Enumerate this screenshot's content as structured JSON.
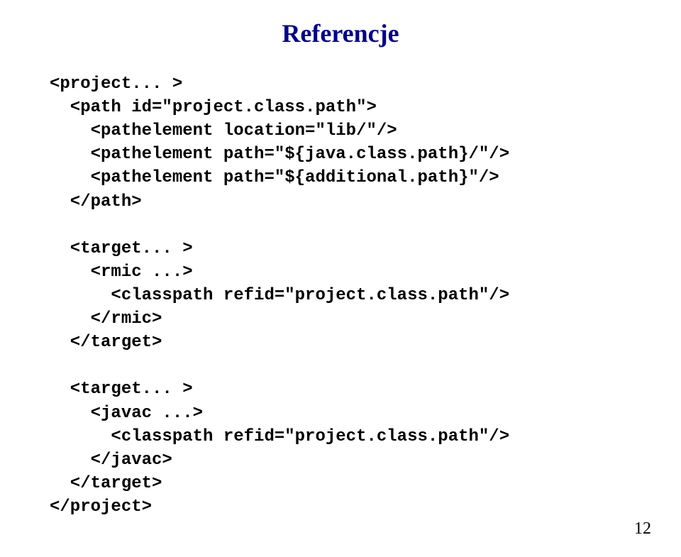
{
  "title": "Referencje",
  "code": "<project... >\n  <path id=\"project.class.path\">\n    <pathelement location=\"lib/\"/>\n    <pathelement path=\"${java.class.path}/\"/>\n    <pathelement path=\"${additional.path}\"/>\n  </path>\n\n  <target... >\n    <rmic ...>\n      <classpath refid=\"project.class.path\"/>\n    </rmic>\n  </target>\n\n  <target... >\n    <javac ...>\n      <classpath refid=\"project.class.path\"/>\n    </javac>\n  </target>\n</project>",
  "page_number": "12"
}
